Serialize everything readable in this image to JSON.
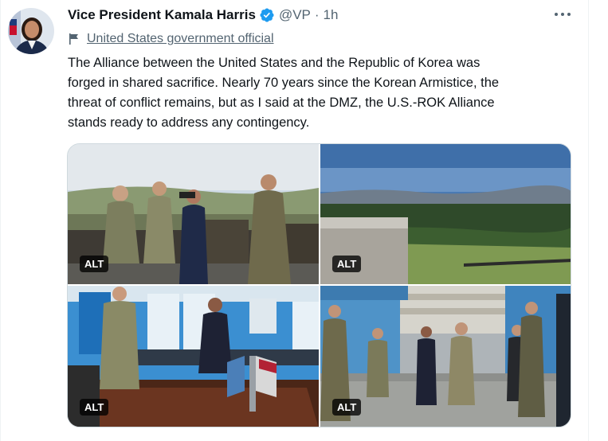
{
  "tweet": {
    "author_name": "Vice President Kamala Harris",
    "handle": "@VP",
    "separator": "·",
    "time": "1h",
    "account_label": "United States government official",
    "text_lines": [
      "The Alliance between the United States and the Republic of Korea was",
      "forged in shared sacrifice. Nearly 70 years since the Korean Armistice, the",
      "threat of conflict remains, but as I said at the DMZ, the U.S.-ROK Alliance",
      "stands ready to address any contingency."
    ]
  },
  "media": {
    "alt_badges": [
      "ALT",
      "ALT",
      "ALT",
      "ALT"
    ]
  },
  "colors": {
    "verified_blue": "#1d9bf0",
    "secondary_text": "#536471",
    "primary_text": "#0f1419"
  },
  "icons": {
    "verified": "verified-badge-icon",
    "label": "flag-icon",
    "more": "more-dots-icon"
  }
}
